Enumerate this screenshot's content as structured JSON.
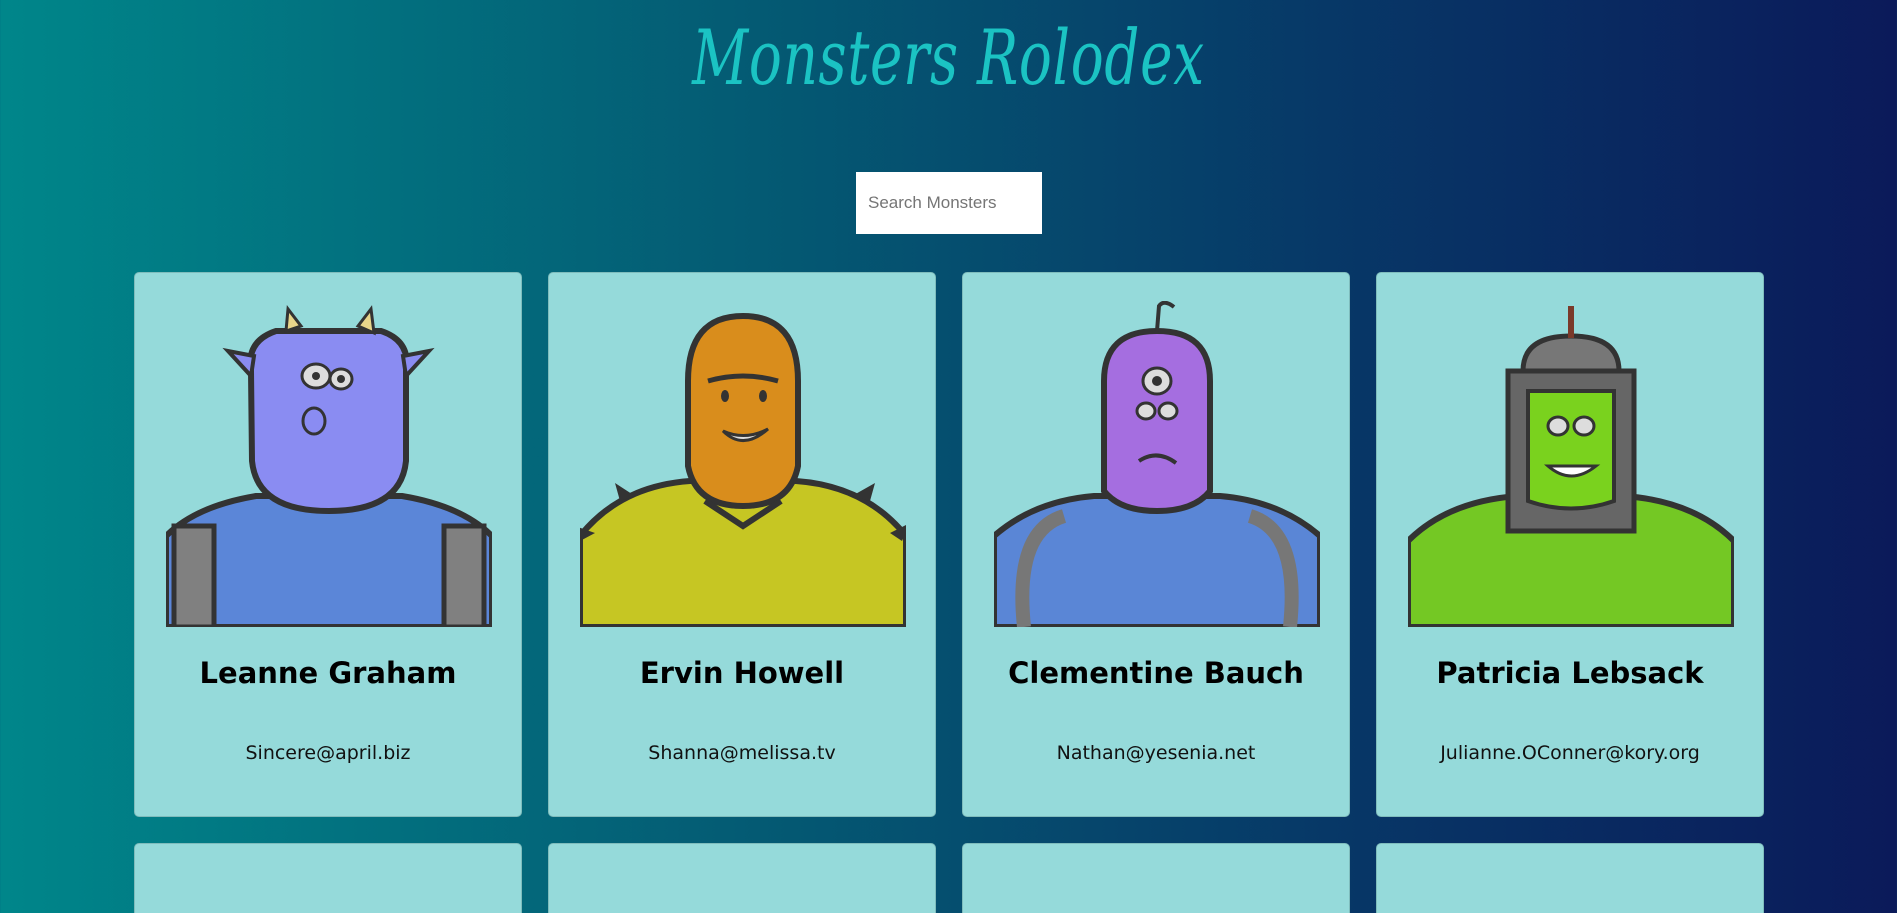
{
  "header": {
    "title": "Monsters Rolodex"
  },
  "search": {
    "placeholder": "Search Monsters",
    "value": ""
  },
  "monsters": [
    {
      "name": "Leanne Graham",
      "email": "Sincere@april.biz",
      "color": "#8a8cf2",
      "body": "#5b86d8"
    },
    {
      "name": "Ervin Howell",
      "email": "Shanna@melissa.tv",
      "color": "#d98d1c",
      "body": "#c6c623"
    },
    {
      "name": "Clementine Bauch",
      "email": "Nathan@yesenia.net",
      "color": "#a56ee0",
      "body": "#5a86d6"
    },
    {
      "name": "Patricia Lebsack",
      "email": "Julianne.OConner@kory.org",
      "color": "#7ad21e",
      "body": "#74c824"
    }
  ]
}
